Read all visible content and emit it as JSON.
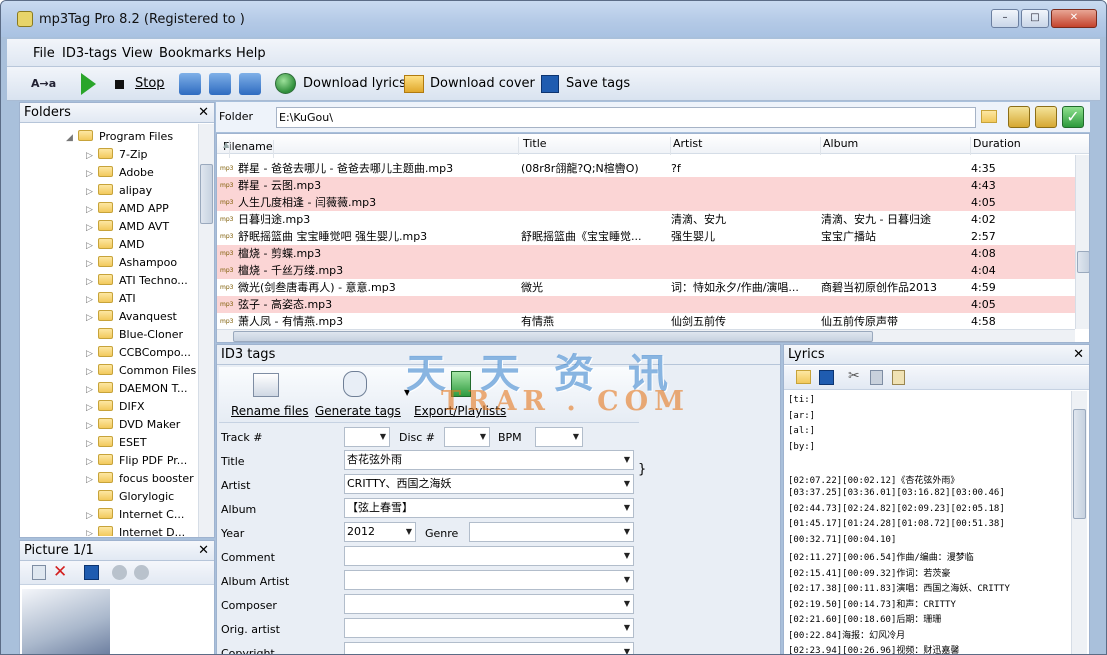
{
  "window": {
    "title": "mp3Tag Pro 8.2 (Registered to )"
  },
  "menu": [
    "File",
    "ID3-tags",
    "View",
    "Bookmarks",
    "Help"
  ],
  "toolbar": {
    "mode": "A→a",
    "stop": "Stop",
    "download_lyrics": "Download lyrics",
    "download_cover": "Download cover",
    "save_tags": "Save tags"
  },
  "folders": {
    "header": "Folders",
    "items": [
      "Program Files",
      "7-Zip",
      "Adobe",
      "alipay",
      "AMD APP",
      "AMD AVT",
      "AMD",
      "Ashampoo",
      "ATI Techno...",
      "ATI",
      "Avanquest",
      "Blue-Cloner",
      "CCBCompo...",
      "Common Files",
      "DAEMON T...",
      "DIFX",
      "DVD Maker",
      "ESET",
      "Flip PDF Pr...",
      "focus booster",
      "Glorylogic",
      "Internet C...",
      "Internet D..."
    ]
  },
  "picture": {
    "header": "Picture 1/1"
  },
  "folderbar": {
    "label": "Folder",
    "path": "E:\\KuGou\\"
  },
  "filelist": {
    "columns": [
      "Filename",
      "Title",
      "Artist",
      "Album",
      "Duration"
    ],
    "rows": [
      {
        "file": "群星 - 爸爸去哪儿 - 爸爸去哪儿主题曲.mp3",
        "title": "(08r8r翖龍?Q;N楦轡O)",
        "artist": "?f",
        "album": "",
        "duration": "4:35",
        "pink": false
      },
      {
        "file": "群星 - 云图.mp3",
        "title": "",
        "artist": "",
        "album": "",
        "duration": "4:43",
        "pink": true
      },
      {
        "file": "人生几度相逢 - 闫薇薇.mp3",
        "title": "",
        "artist": "",
        "album": "",
        "duration": "4:05",
        "pink": true
      },
      {
        "file": "日暮归途.mp3",
        "title": "",
        "artist": "清滴、安九",
        "album": "清滴、安九 - 日暮归途",
        "duration": "4:02",
        "pink": false
      },
      {
        "file": "舒眠摇篮曲 宝宝睡觉吧 强生婴儿.mp3",
        "title": "舒眠摇篮曲《宝宝睡觉...",
        "artist": "强生婴儿",
        "album": "宝宝广播站",
        "duration": "2:57",
        "pink": false
      },
      {
        "file": "檀烧 - 剪蝶.mp3",
        "title": "",
        "artist": "",
        "album": "",
        "duration": "4:08",
        "pink": true
      },
      {
        "file": "檀烧 - 千丝万缕.mp3",
        "title": "",
        "artist": "",
        "album": "",
        "duration": "4:04",
        "pink": true
      },
      {
        "file": "微光(剑叁唐毒再人) - 意意.mp3",
        "title": "微光",
        "artist": "词：恃如永夕/作曲/演唱...",
        "album": "商碧当初原创作品2013",
        "duration": "4:59",
        "pink": false
      },
      {
        "file": "弦子 - 高姿态.mp3",
        "title": "",
        "artist": "",
        "album": "",
        "duration": "4:05",
        "pink": true
      },
      {
        "file": "萧人凤 - 有情燕.mp3",
        "title": "有情燕",
        "artist": "仙剑五前传",
        "album": "仙五前传原声带",
        "duration": "4:58",
        "pink": false
      }
    ]
  },
  "id3": {
    "header": "ID3 tags",
    "rename_files": "Rename files",
    "generate_tags": "Generate tags",
    "export_playlists": "Export/Playlists",
    "track_label": "Track #",
    "disc_label": "Disc #",
    "bpm_label": "BPM",
    "title_label": "Title",
    "title_value": "杏花弦外雨",
    "artist_label": "Artist",
    "artist_value": "CRITTY、西国之海妖",
    "album_label": "Album",
    "album_value": "【弦上春雪】",
    "year_label": "Year",
    "year_value": "2012",
    "genre_label": "Genre",
    "comment_label": "Comment",
    "album_artist_label": "Album Artist",
    "composer_label": "Composer",
    "orig_artist_label": "Orig. artist",
    "copyright_label": "Copyright",
    "brace": "}"
  },
  "lyrics": {
    "header": "Lyrics",
    "lines": [
      "[ti:]",
      "[ar:]",
      "[al:]",
      "[by:]",
      "",
      "[02:07.22][00:02.12]《杏花弦外雨》",
      "[03:37.25][03:36.01][03:16.82][03:00.46]",
      "[02:44.73][02:24.82][02:09.23][02:05.18]",
      "[01:45.17][01:24.28][01:08.72][00:51.38]",
      "[00:32.71][00:04.10]",
      "[02:11.27][00:06.54]作曲/编曲：漫梦临",
      "[02:15.41][00:09.32]作词：若茨豪",
      "[02:17.38][00:11.83]演唱：西国之海妖、CRITTY",
      "[02:19.50][00:14.73]和声：CRITTY",
      "[02:21.60][00:18.60]后期：珊珊",
      "[00:22.84]海报：幻风冷月",
      "[02:23.94][00:26.96]视频：财迅嘉馨"
    ]
  },
  "watermark": {
    "cn": "天天资讯",
    "en": "TRAR . COM"
  },
  "colors": {
    "accent": "#a9c0db",
    "pink_row": "#fbd5d5"
  }
}
